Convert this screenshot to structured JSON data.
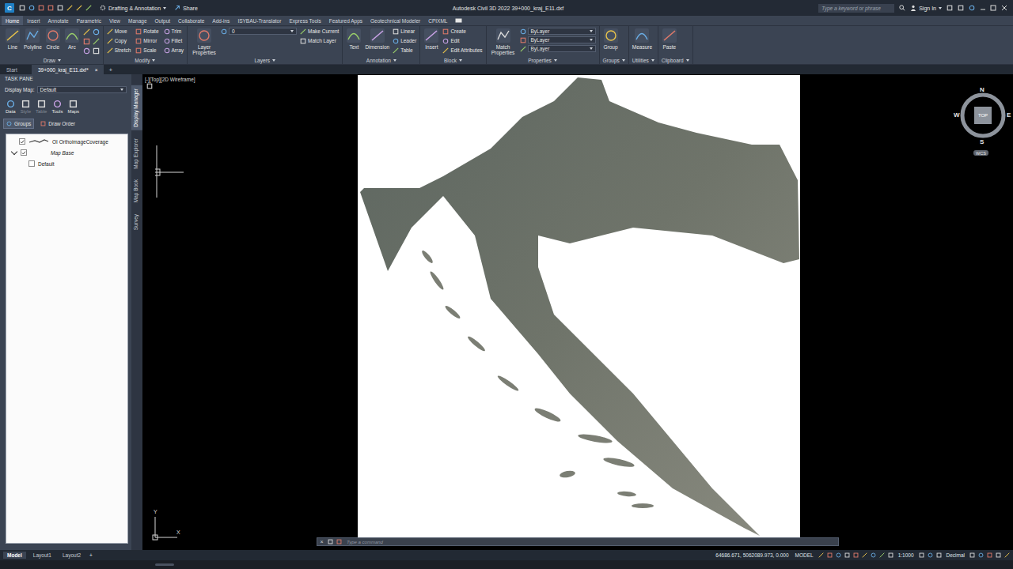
{
  "title_bar": {
    "app_logo": "C",
    "workspace": "Drafting & Annotation",
    "share": "Share",
    "title": "Autodesk Civil 3D 2022   39+000_kraj_E11.dxf",
    "search_placeholder": "Type a keyword or phrase",
    "sign_in": "Sign In"
  },
  "ribbon_tabs": [
    {
      "label": "Home",
      "selected": true
    },
    {
      "label": "Insert",
      "selected": false
    },
    {
      "label": "Annotate",
      "selected": false
    },
    {
      "label": "Parametric",
      "selected": false
    },
    {
      "label": "View",
      "selected": false
    },
    {
      "label": "Manage",
      "selected": false
    },
    {
      "label": "Output",
      "selected": false
    },
    {
      "label": "Collaborate",
      "selected": false
    },
    {
      "label": "Add-ins",
      "selected": false
    },
    {
      "label": "ISYBAU-Translator",
      "selected": false
    },
    {
      "label": "Express Tools",
      "selected": false
    },
    {
      "label": "Featured Apps",
      "selected": false
    },
    {
      "label": "Geotechnical Modeler",
      "selected": false
    },
    {
      "label": "CPIXML",
      "selected": false
    }
  ],
  "ribbon_panels": [
    {
      "title": "Draw",
      "large": [
        "Line",
        "Polyline",
        "Circle",
        "Arc"
      ],
      "dropdowns": [],
      "small": []
    },
    {
      "title": "Modify",
      "large": [],
      "dropdowns": [],
      "small": [
        "Move",
        "Rotate",
        "Trim",
        "Copy",
        "Mirror",
        "Fillet",
        "Stretch",
        "Scale",
        "Array"
      ]
    },
    {
      "title": "Layers",
      "large": [
        "Layer Properties"
      ],
      "dropdowns": [
        "0"
      ],
      "small": [
        "Make Current",
        "Match Layer"
      ]
    },
    {
      "title": "Annotation",
      "large": [
        "Text",
        "Dimension"
      ],
      "dropdowns": [],
      "small": [
        "Linear",
        "Leader",
        "Table"
      ]
    },
    {
      "title": "Block",
      "large": [
        "Insert"
      ],
      "dropdowns": [],
      "small": [
        "Create",
        "Edit",
        "Edit Attributes"
      ]
    },
    {
      "title": "Properties",
      "large": [
        "Match Properties"
      ],
      "dropdowns": [
        "ByLayer",
        "ByLayer",
        "ByLayer"
      ],
      "small": []
    },
    {
      "title": "Groups",
      "large": [
        "Group"
      ],
      "dropdowns": [],
      "small": []
    },
    {
      "title": "Utilities",
      "large": [
        "Measure"
      ],
      "dropdowns": [],
      "small": []
    },
    {
      "title": "Clipboard",
      "large": [
        "Paste"
      ],
      "dropdowns": [],
      "small": []
    }
  ],
  "file_tabs": [
    {
      "label": "Start",
      "selected": false,
      "closable": false
    },
    {
      "label": "39+000_kraj_E11.dxf*",
      "selected": true,
      "closable": true
    }
  ],
  "file_tab_close": "×",
  "file_tab_add": "+",
  "task_pane": {
    "header": "TASK PANE",
    "display_map_label": "Display Map:",
    "display_map_value": "Default",
    "tools": [
      {
        "label": "Data",
        "disabled": false
      },
      {
        "label": "Style",
        "disabled": true
      },
      {
        "label": "Table",
        "disabled": true
      },
      {
        "label": "Tools",
        "disabled": false
      },
      {
        "label": "Maps",
        "disabled": false
      }
    ],
    "buttons": [
      {
        "label": "Groups",
        "selected": true
      },
      {
        "label": "Draw Order",
        "selected": false
      }
    ],
    "layers": [
      {
        "label": "OI OrthoimageCoverage",
        "kind": "layer",
        "checked": true,
        "expanded": false
      },
      {
        "label": "Map Base",
        "kind": "group",
        "checked": true,
        "expanded": true
      },
      {
        "label": "Default",
        "kind": "style",
        "checked": false,
        "expanded": false
      }
    ],
    "side_tabs": [
      {
        "label": "Display Manager",
        "selected": true
      },
      {
        "label": "Map Explorer",
        "selected": false
      },
      {
        "label": "Map Book",
        "selected": false
      },
      {
        "label": "Survey",
        "selected": false
      }
    ]
  },
  "viewport": {
    "label": "[-][Top][2D Wireframe]",
    "compass": {
      "north": "N",
      "south": "S",
      "west": "W",
      "east": "E",
      "top": "TOP",
      "ucs": "WCS"
    },
    "ucs_y": "Y",
    "ucs_x": "X"
  },
  "command_line": {
    "placeholder": "Type a command",
    "close": "×"
  },
  "status_bar": {
    "layouts": [
      {
        "label": "Model",
        "selected": true
      },
      {
        "label": "Layout1",
        "selected": false
      },
      {
        "label": "Layout2",
        "selected": false
      }
    ],
    "add": "+",
    "coordinates": "64686.671, 5062089.973, 0.000",
    "space": "MODEL",
    "scale": "1:1000",
    "units": "Decimal"
  }
}
